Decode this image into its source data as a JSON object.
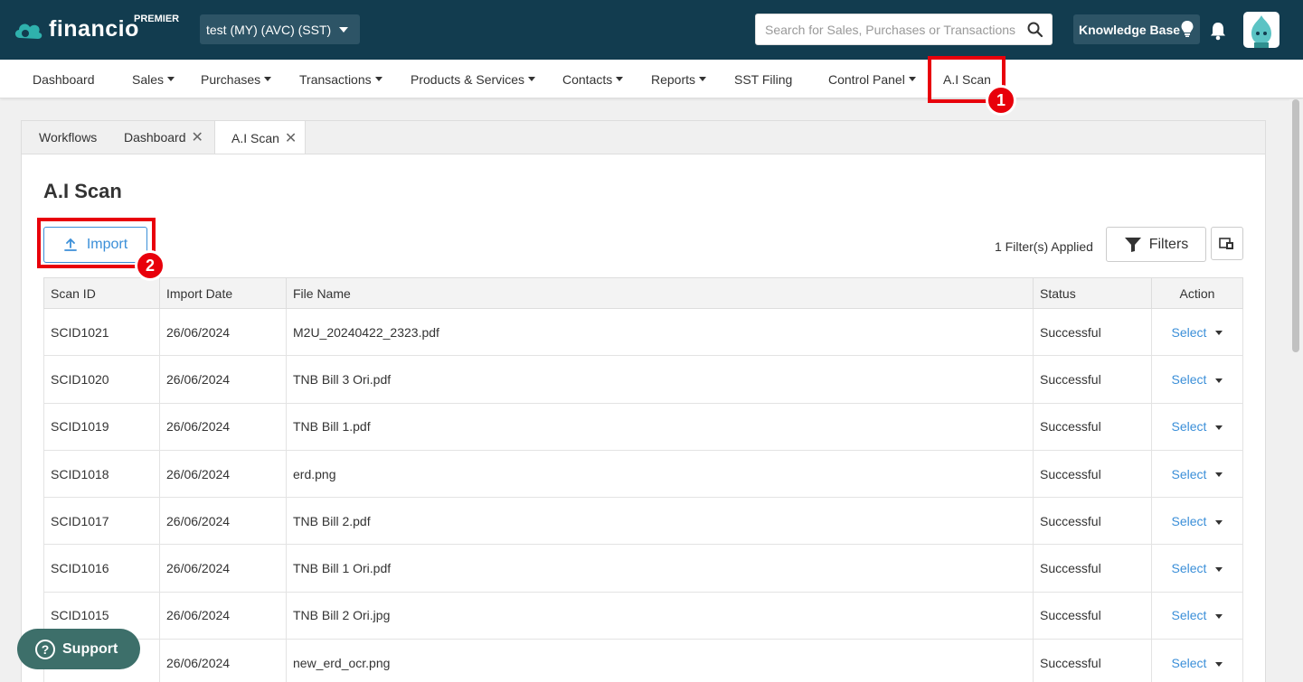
{
  "header": {
    "logo_text": "financio",
    "logo_badge": "PREMIER",
    "company": "test (MY) (AVC) (SST)",
    "search_placeholder": "Search for Sales, Purchases or Transactions",
    "knowledge_base": "Knowledge Base"
  },
  "nav": {
    "items": [
      {
        "label": "Dashboard"
      },
      {
        "label": "Sales"
      },
      {
        "label": "Purchases"
      },
      {
        "label": "Transactions"
      },
      {
        "label": "Products & Services"
      },
      {
        "label": "Contacts"
      },
      {
        "label": "Reports"
      },
      {
        "label": "SST Filing"
      },
      {
        "label": "Control Panel"
      },
      {
        "label": "A.I Scan"
      }
    ]
  },
  "annotations": {
    "step1": "1",
    "step2": "2"
  },
  "tabs": [
    {
      "label": "Workflows"
    },
    {
      "label": "Dashboard"
    },
    {
      "label": "A.I Scan"
    }
  ],
  "page": {
    "title": "A.I Scan",
    "import_label": "Import",
    "filters_applied": "1 Filter(s) Applied",
    "filters_label": "Filters"
  },
  "table": {
    "columns": [
      "Scan ID",
      "Import Date",
      "File Name",
      "Status",
      "Action"
    ],
    "select_label": "Select",
    "rows": [
      {
        "id": "SCID1021",
        "date": "26/06/2024",
        "file": "M2U_20240422_2323.pdf",
        "status": "Successful"
      },
      {
        "id": "SCID1020",
        "date": "26/06/2024",
        "file": "TNB Bill 3 Ori.pdf",
        "status": "Successful"
      },
      {
        "id": "SCID1019",
        "date": "26/06/2024",
        "file": "TNB Bill 1.pdf",
        "status": "Successful"
      },
      {
        "id": "SCID1018",
        "date": "26/06/2024",
        "file": "erd.png",
        "status": "Successful"
      },
      {
        "id": "SCID1017",
        "date": "26/06/2024",
        "file": "TNB Bill 2.pdf",
        "status": "Successful"
      },
      {
        "id": "SCID1016",
        "date": "26/06/2024",
        "file": "TNB Bill 1 Ori.pdf",
        "status": "Successful"
      },
      {
        "id": "SCID1015",
        "date": "26/06/2024",
        "file": "TNB Bill 2 Ori.jpg",
        "status": "Successful"
      },
      {
        "id": "",
        "date": "26/06/2024",
        "file": "new_erd_ocr.png",
        "status": "Successful"
      }
    ]
  },
  "support": {
    "label": "Support"
  },
  "colors": {
    "header_bg": "#123c4f",
    "accent_blue": "#3b8fd8",
    "highlight_red": "#e8000b",
    "support_bg": "#3d6f6a"
  }
}
